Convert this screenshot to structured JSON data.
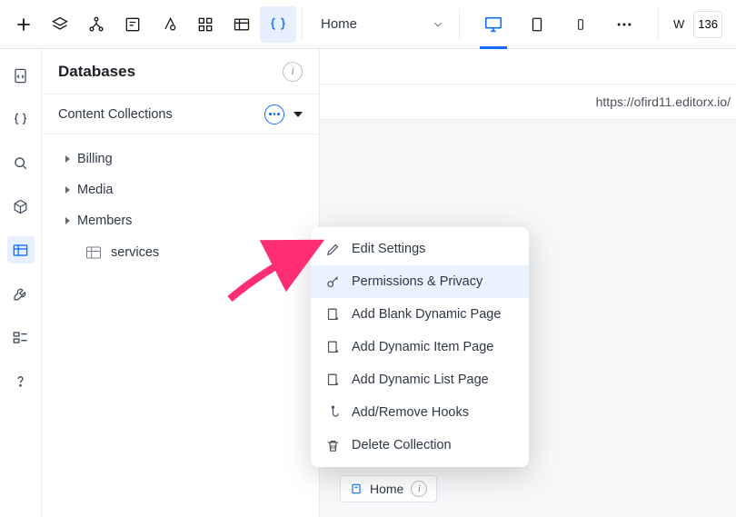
{
  "topbar": {
    "page_select": "Home",
    "size_label": "W",
    "size_value": "136"
  },
  "panel": {
    "title": "Databases",
    "section": "Content Collections",
    "tree": [
      {
        "label": "Billing"
      },
      {
        "label": "Media"
      },
      {
        "label": "Members"
      }
    ],
    "leaf": "services"
  },
  "canvas": {
    "url": "https://ofird11.editorx.io/",
    "home_chip": "Home"
  },
  "context_menu": {
    "items": [
      {
        "label": "Edit Settings"
      },
      {
        "label": "Permissions & Privacy"
      },
      {
        "label": "Add Blank Dynamic Page"
      },
      {
        "label": "Add Dynamic Item Page"
      },
      {
        "label": "Add Dynamic List Page"
      },
      {
        "label": "Add/Remove Hooks"
      },
      {
        "label": "Delete Collection"
      }
    ],
    "highlighted_index": 1
  }
}
